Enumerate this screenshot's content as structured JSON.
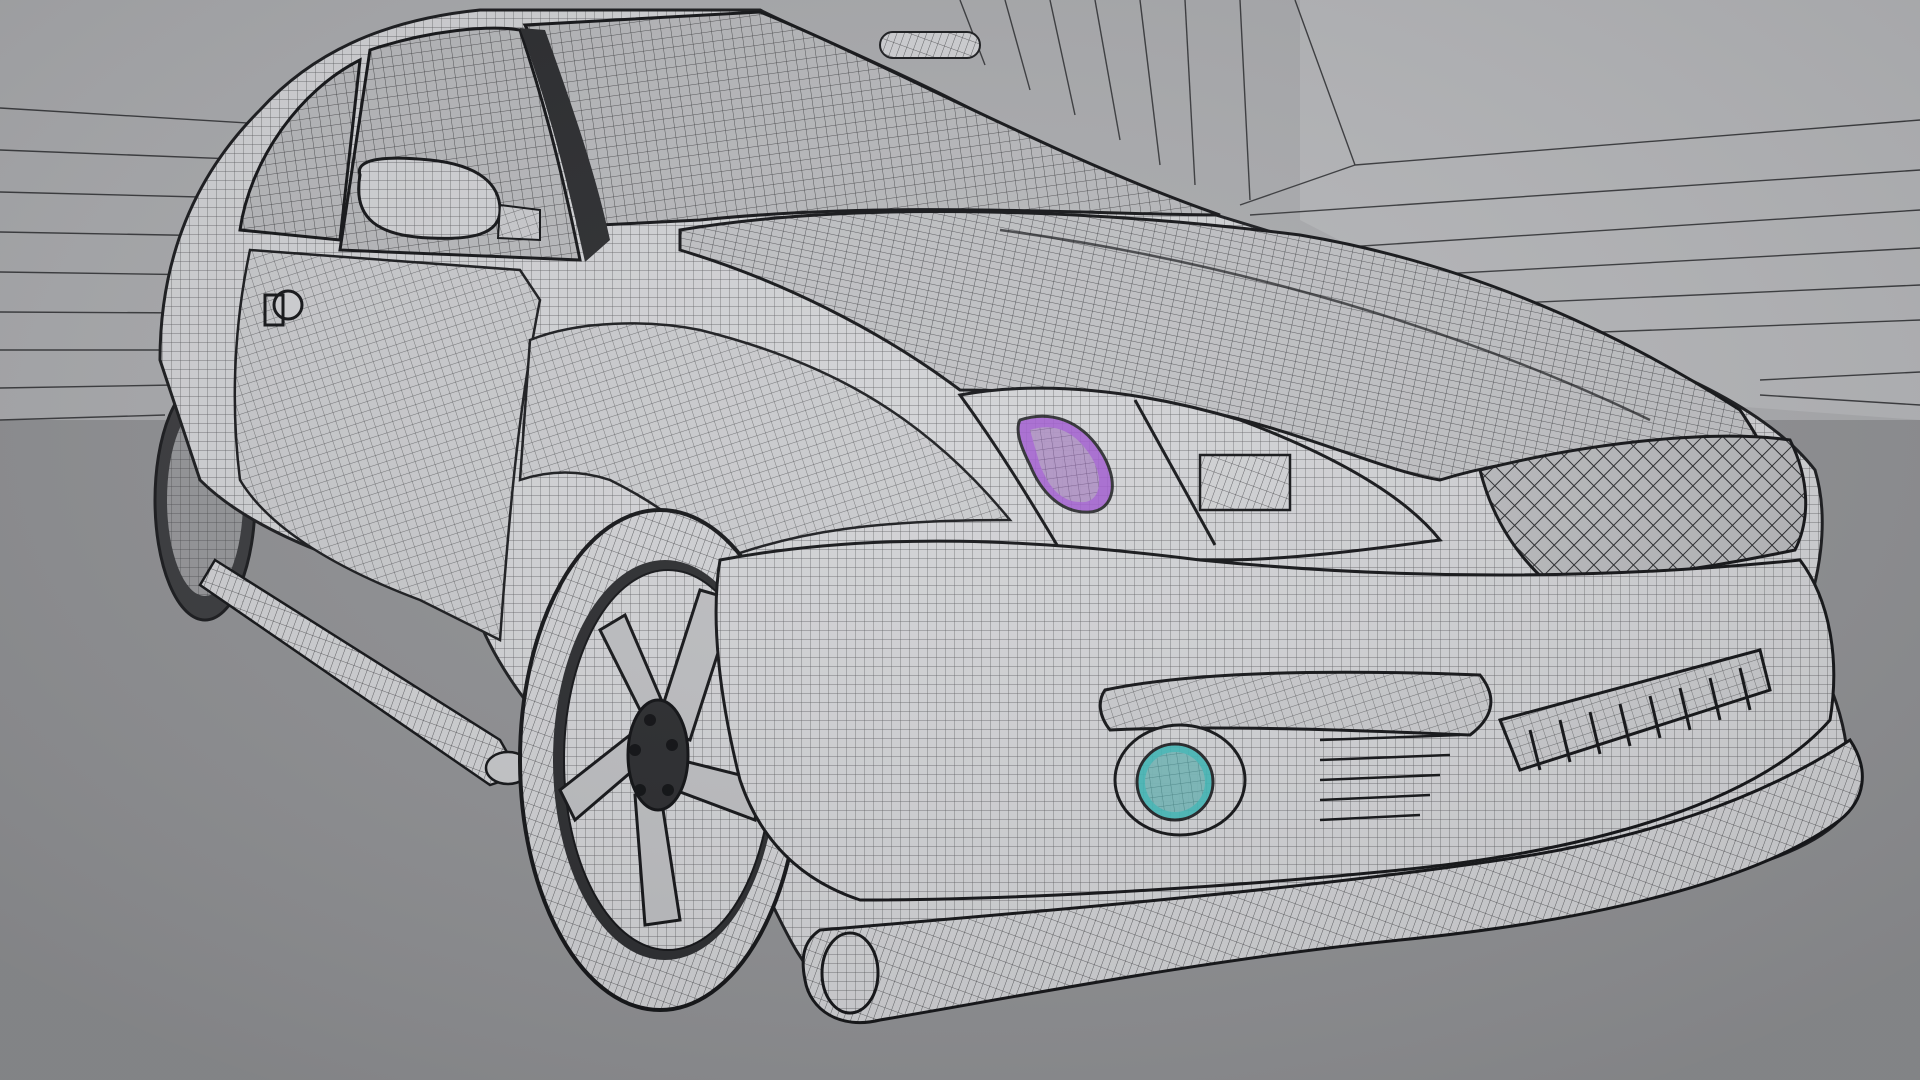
{
  "scene": {
    "subject": "car-wireframe-render",
    "background_wall_color": "#a9aaad",
    "floor_color": "#8f9093",
    "body_color": "#d0d1d4",
    "wire_color": "#2a2b2e",
    "headlight_accent_color": "#a05ad0",
    "foglight_accent_color": "#3fb8b8"
  }
}
